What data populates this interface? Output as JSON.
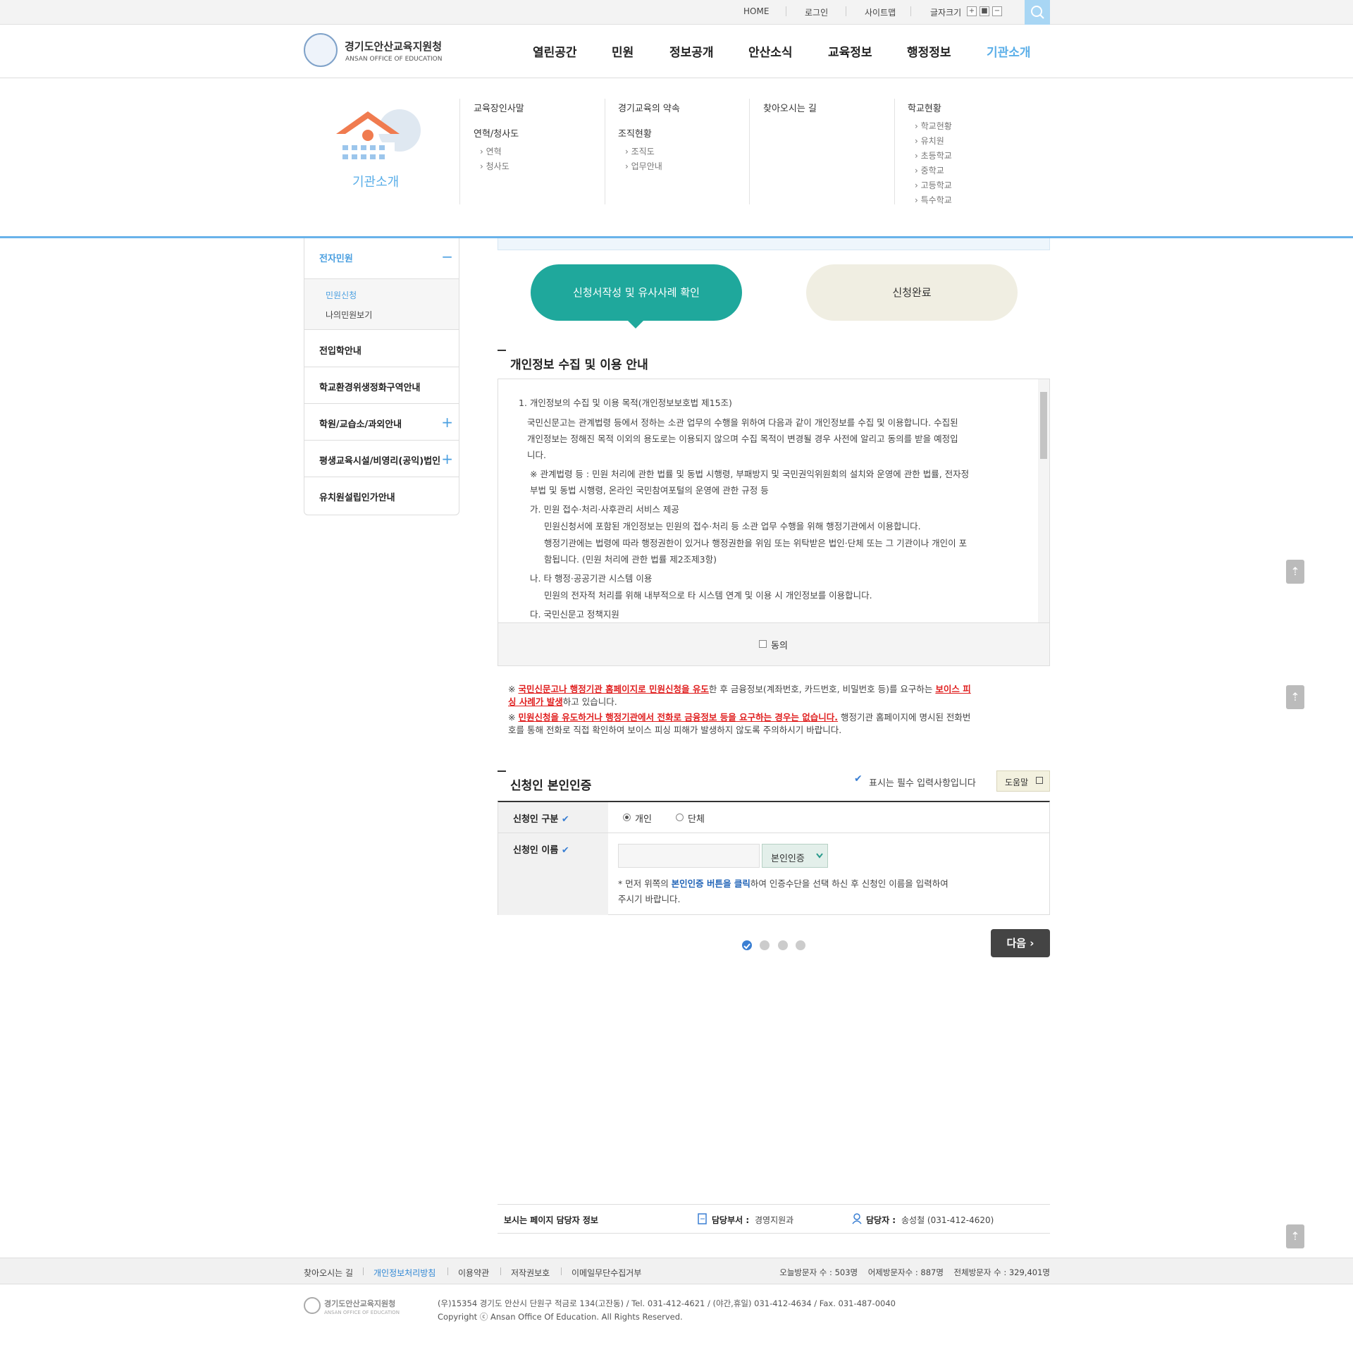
{
  "top_links": {
    "home": "HOME",
    "login": "로그인",
    "sitemap": "사이트맵",
    "font_size": "글자크기",
    "plus": "+",
    "reset": "■",
    "minus": "−"
  },
  "logo": {
    "name": "경기도안산교육지원청",
    "sub": "ANSAN OFFICE OF EDUCATION"
  },
  "gnb": [
    "열린공간",
    "민원",
    "정보공개",
    "안산소식",
    "교육정보",
    "행정정보",
    "기관소개"
  ],
  "mega": {
    "label": "기관소개",
    "col1": {
      "a": "교육장인사말",
      "b": "연혁/청사도",
      "b1": "› 연혁",
      "b2": "› 청사도"
    },
    "col2": {
      "a": "경기교육의 약속",
      "b": "조직현황",
      "b1": "› 조직도",
      "b2": "› 업무안내"
    },
    "col3": {
      "a": "찾아오시는 길"
    },
    "col4": {
      "a": "학교현황",
      "items": [
        "› 학교현황",
        "› 유치원",
        "› 초등학교",
        "› 중학교",
        "› 고등학교",
        "› 특수학교"
      ]
    }
  },
  "lnb": {
    "title": "전자민원",
    "sub1": "민원신청",
    "sub2": "나의민원보기",
    "items": [
      "전입학안내",
      "학교환경위생정화구역안내",
      "학원/교습소/과외안내",
      "평생교육시설/비영리(공익)법인",
      "유치원설립인가안내"
    ],
    "plus": "+",
    "minus": "−"
  },
  "steps": {
    "s1": "신청서작성 및 유사사례 확인",
    "s2": "신청완료"
  },
  "privacy": {
    "title": "개인정보 수집 및 이용 안내",
    "lines": [
      "1. 개인정보의 수집 및 이용 목적(개인정보보호법 제15조)",
      "국민신문고는 관계법령 등에서 정하는 소관 업무의 수행을 위하여 다음과 같이 개인정보를 수집 및 이용합니다. 수집된",
      "개인정보는 정해진 목적 이외의 용도로는 이용되지 않으며 수집 목적이 변경될 경우 사전에 알리고 동의를 받을 예정입",
      "니다.",
      "※ 관계법령 등 : 민원 처리에 관한 법률 및 동법 시행령, 부패방지 및 국민권익위원회의 설치와 운영에 관한 법률, 전자정",
      "부법 및 동법 시행령, 온라인 국민참여포털의 운영에 관한 규정 등",
      "가. 민원 접수·처리·사후관리 서비스 제공",
      "민원신청서에 포함된 개인정보는 민원의 접수·처리 등 소관 업무 수행을 위해 행정기관에서 이용합니다.",
      "행정기관에는 법령에 따라 행정권한이 있거나 행정권한을 위임 또는 위탁받은 법인·단체 또는 그 기관이나 개인이 포",
      "함됩니다. (민원 처리에 관한 법률 제2조제3항)",
      "나. 타 행정·공공기관 시스템 이용",
      "민원의 전자적 처리를 위해 내부적으로 타 시스템 연계 및 이용 시 개인정보를 이용합니다.",
      "다. 국민신문고 정책지원"
    ],
    "agree": "동의"
  },
  "warning": {
    "w1a": "※ ",
    "w1b": "국민신문고나 행정기관 홈페이지로 민원신청을 유도",
    "w1c": "한 후 금융정보(계좌번호, 카드번호, 비밀번호 등)를 요구하는 ",
    "w1d": "보이스 피",
    "w1e": "싱 사례가 발생",
    "w1f": "하고 있습니다.",
    "w2a": "※ ",
    "w2b": "민원신청을 유도하거나 행정기관에서 전화로 금융정보 등을 요구하는 경우는 없습니다.",
    "w2c": " 행정기관 홈페이지에 명시된 전화번",
    "w2d": "호를 통해 전화로 직접 확인하여 보이스 피싱 피해가 발생하지 않도록 주의하시기 바랍니다."
  },
  "identity": {
    "title": "신청인 본인인증",
    "required": "표시는 필수 입력사항입니다",
    "help": "도움말",
    "row1_label": "신청인 구분",
    "opt1": "개인",
    "opt2": "단체",
    "row2_label": "신청인 이름",
    "auth_btn": "본인인증",
    "note_a": "* 먼저 위쪽의 ",
    "note_b": "본인인증 버튼을 클릭",
    "note_c": "하여 인증수단을 선택 하신 후 신청인 이름을 입력하여",
    "note_d": "주시기 바랍니다.",
    "check": "✔"
  },
  "next": "다음 ›",
  "manager": {
    "label": "보시는 페이지 담당자 정보",
    "dept_label": "담당부서 :",
    "dept": "경영지원과",
    "person_label": "담당자 :",
    "person": "송성철 (031-412-4620)"
  },
  "footer": {
    "links": [
      "찾아오시는 길",
      "개인정보처리방침",
      "이용약관",
      "저작권보호",
      "이메일무단수집거부"
    ],
    "stats": "오늘방문자 수 : 503명    어제방문자수 : 887명    전체방문자 수 : 329,401명",
    "addr": "(우)15354 경기도 안산시 단원구 적금로 134(고잔동) / Tel. 031-412-4621 / (야간,휴일) 031-412-4634 / Fax. 031-487-0040",
    "copy": "Copyright ⓒ Ansan Office Of Education. All Rights Reserved.",
    "logo": "경기도안산교육지원청",
    "logo_sub": "ANSAN OFFICE OF EDUCATION"
  },
  "colors": {
    "accent": "#1fa89c",
    "link_blue": "#4a9fe0",
    "warning_red": "#e02020"
  }
}
